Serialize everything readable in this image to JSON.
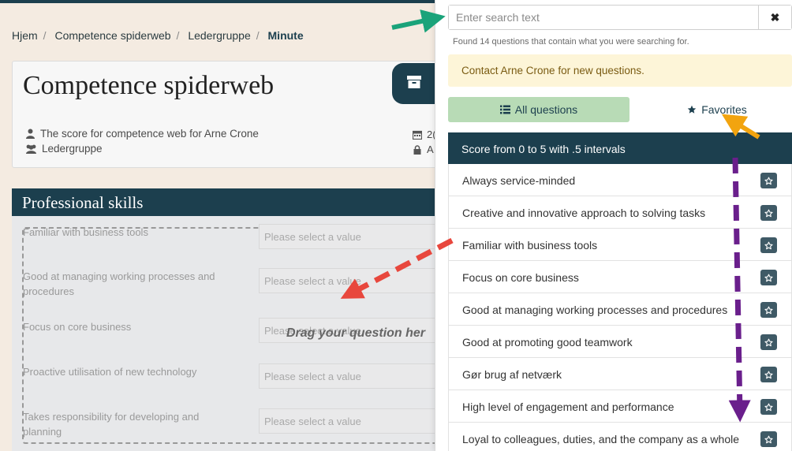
{
  "breadcrumb": {
    "items": [
      "Hjem",
      "Competence spiderweb",
      "Ledergruppe"
    ],
    "active": "Minute"
  },
  "card": {
    "title": "Competence spiderweb",
    "description": "The score for competence web for Arne Crone",
    "group": "Ledergruppe",
    "date_partial": "2(",
    "status_partial": "A"
  },
  "section": {
    "title": "Professional skills",
    "drag_hint": "Drag your question her",
    "background_questions": [
      "Familiar with business tools",
      "Good at managing working processes and procedures",
      "Focus on core business",
      "Proactive utilisation of new technology",
      "Takes responsibility for developing and planning"
    ],
    "select_placeholder": "Please select a value"
  },
  "panel": {
    "search": {
      "placeholder": "Enter search text",
      "value": ""
    },
    "clear_label": "✖",
    "found_text": "Found 14 questions that contain what you were searching for.",
    "alert": "Contact Arne Crone for new questions.",
    "tabs": {
      "all": "All questions",
      "favorites": "Favorites"
    },
    "score_header": "Score from 0 to 5 with .5 intervals",
    "questions": [
      "Always service-minded",
      "Creative and innovative approach to solving tasks",
      "Familiar with business tools",
      "Focus on core business",
      "Good at managing working processes and procedures",
      "Good at promoting good teamwork",
      "Gør brug af netværk",
      "High level of engagement and performance",
      "Loyal to colleagues, duties, and the company as a whole"
    ]
  },
  "colors": {
    "brand_dark": "#1c3f4e",
    "tab_active": "#b8dbb6",
    "alert_bg": "#fdf5d8",
    "arrow_green": "#1aa37a",
    "arrow_orange": "#f2a40f",
    "arrow_red": "#e8473d",
    "arrow_purple": "#6a1f8c"
  }
}
